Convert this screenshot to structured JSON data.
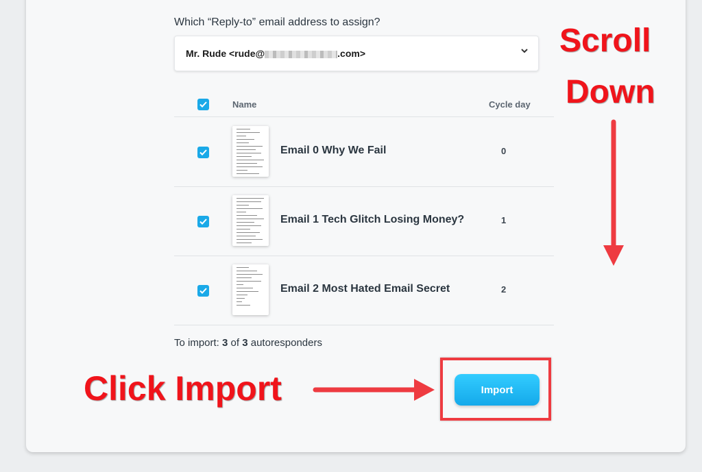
{
  "form": {
    "question": "Which “Reply-to” email address to assign?",
    "reply_to_prefix": "Mr. Rude <rude@",
    "reply_to_suffix": ".com>",
    "chevron_icon": "chevron-down-icon"
  },
  "table": {
    "headers": {
      "name": "Name",
      "cycle_day": "Cycle day"
    },
    "rows": [
      {
        "name": "Email 0 Why We Fail",
        "cycle_day": "0",
        "checked": true
      },
      {
        "name": "Email 1 Tech Glitch Losing Money?",
        "cycle_day": "1",
        "checked": true
      },
      {
        "name": "Email 2 Most Hated Email Secret",
        "cycle_day": "2",
        "checked": true
      }
    ]
  },
  "summary": {
    "prefix": "To import: ",
    "count": "3",
    "of": " of ",
    "total": "3",
    "suffix": " autoresponders"
  },
  "import_button": {
    "label": "Import"
  },
  "annotations": {
    "scroll": "Scroll",
    "down": "Down",
    "click_import": "Click Import"
  },
  "colors": {
    "accent": "#1aa9e8",
    "annotation_red": "#f0141b"
  }
}
